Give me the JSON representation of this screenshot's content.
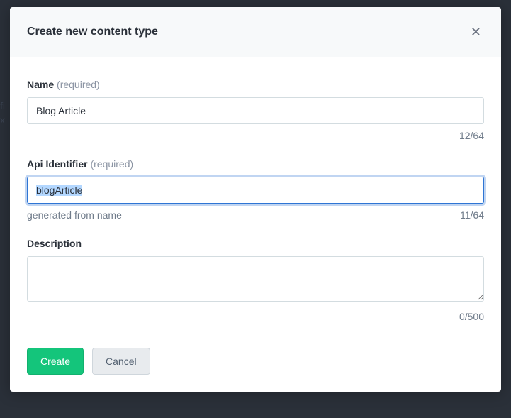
{
  "backdrop": {
    "line1": "fi",
    "line2": "x"
  },
  "modal": {
    "title": "Create new content type",
    "fields": {
      "name": {
        "label": "Name",
        "required_text": "(required)",
        "value": "Blog Article",
        "counter": "12/64"
      },
      "api": {
        "label": "Api Identifier",
        "required_text": "(required)",
        "value": "blogArticle",
        "helper": "generated from name",
        "counter": "11/64"
      },
      "description": {
        "label": "Description",
        "value": "",
        "counter": "0/500"
      }
    },
    "buttons": {
      "create": "Create",
      "cancel": "Cancel"
    }
  }
}
